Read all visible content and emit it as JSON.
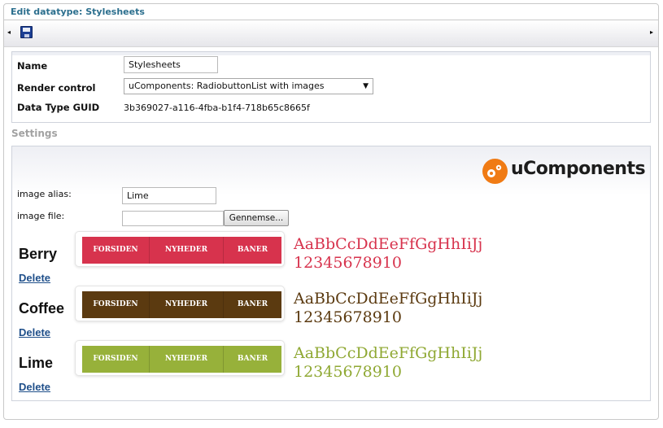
{
  "panel": {
    "title": "Edit datatype: Stylesheets"
  },
  "toolbar": {
    "left_arrow": "◂",
    "right_arrow": "▸"
  },
  "fields": {
    "name_label": "Name",
    "name_value": "Stylesheets",
    "render_label": "Render control",
    "render_value": "uComponents: RadiobuttonList with images",
    "render_caret": "▼",
    "guid_label": "Data Type GUID",
    "guid_value": "3b369027-a116-4fba-b1f4-718b65c8665f"
  },
  "settings": {
    "title": "Settings",
    "logo_text": "uComponents",
    "alias_label": "image alias:",
    "alias_value": "Lime",
    "file_label": "image file:",
    "file_value": "",
    "browse_label": "Gennemse..."
  },
  "styles": [
    {
      "name": "Berry",
      "delete": "Delete",
      "color": "#d7334d",
      "bar_color": "#d7334d",
      "menu": [
        "FORSIDEN",
        "NYHEDER",
        "BANER"
      ],
      "letters": "AaBbCcDdEeFfGgHhIiJj",
      "numbers": "12345678910"
    },
    {
      "name": "Coffee",
      "delete": "Delete",
      "color": "#5b3a10",
      "bar_color": "#5b3a10",
      "menu": [
        "FORSIDEN",
        "NYHEDER",
        "BANER"
      ],
      "letters": "AaBbCcDdEeFfGgHhIiJj",
      "numbers": "12345678910"
    },
    {
      "name": "Lime",
      "delete": "Delete",
      "color": "#8fa833",
      "bar_color": "#97b13a",
      "menu": [
        "FORSIDEN",
        "NYHEDER",
        "BANER"
      ],
      "letters": "AaBbCcDdEeFfGgHhIiJj",
      "numbers": "12345678910"
    }
  ]
}
